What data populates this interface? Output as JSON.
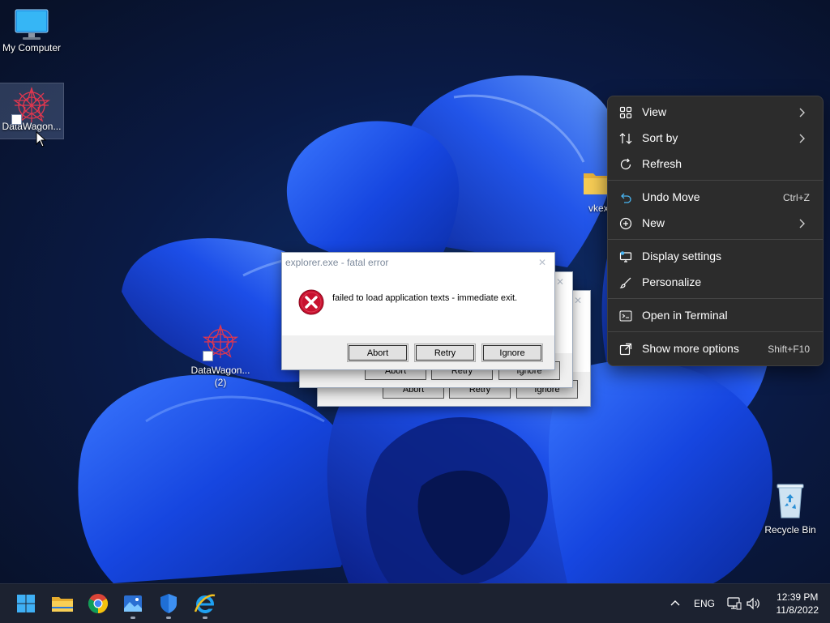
{
  "desktop": {
    "icons": [
      {
        "label": "My Computer"
      },
      {
        "label": "DataWagon..."
      },
      {
        "label": "DataWagon..."
      },
      {
        "label": "(2)"
      },
      {
        "label": "vkex"
      },
      {
        "label": "Recycle Bin"
      }
    ]
  },
  "dialog": {
    "title": "explorer.exe - fatal error",
    "message": "failed to load application texts - immediate exit.",
    "buttons": {
      "abort": "Abort",
      "retry": "Retry",
      "ignore": "Ignore"
    },
    "close_glyph": "✕"
  },
  "context_menu": {
    "items": [
      {
        "label": "View",
        "icon": "grid-icon",
        "shortcut": "",
        "submenu": true
      },
      {
        "label": "Sort by",
        "icon": "sort-icon",
        "shortcut": "",
        "submenu": true
      },
      {
        "label": "Refresh",
        "icon": "refresh-icon",
        "shortcut": "",
        "submenu": false
      },
      {
        "label": "Undo Move",
        "icon": "undo-icon",
        "shortcut": "Ctrl+Z",
        "submenu": false
      },
      {
        "label": "New",
        "icon": "plus-circle-icon",
        "shortcut": "",
        "submenu": true
      },
      {
        "label": "Display settings",
        "icon": "display-icon",
        "shortcut": "",
        "submenu": false
      },
      {
        "label": "Personalize",
        "icon": "brush-icon",
        "shortcut": "",
        "submenu": false
      },
      {
        "label": "Open in Terminal",
        "icon": "terminal-icon",
        "shortcut": "",
        "submenu": false
      },
      {
        "label": "Show more options",
        "icon": "external-icon",
        "shortcut": "Shift+F10",
        "submenu": false
      }
    ]
  },
  "taskbar": {
    "apps": [
      "start-icon",
      "file-explorer-icon",
      "chrome-icon",
      "photos-icon",
      "defender-icon",
      "internet-explorer-icon"
    ],
    "tray": {
      "chevron": "^",
      "language": "ENG"
    },
    "clock": {
      "time": "12:39 PM",
      "date": "11/8/2022"
    }
  },
  "colors": {
    "accent": "#1e4fe0",
    "menu_bg": "#2c2c2c",
    "taskbar_bg": "#1c2230",
    "error_red": "#c8102e"
  }
}
